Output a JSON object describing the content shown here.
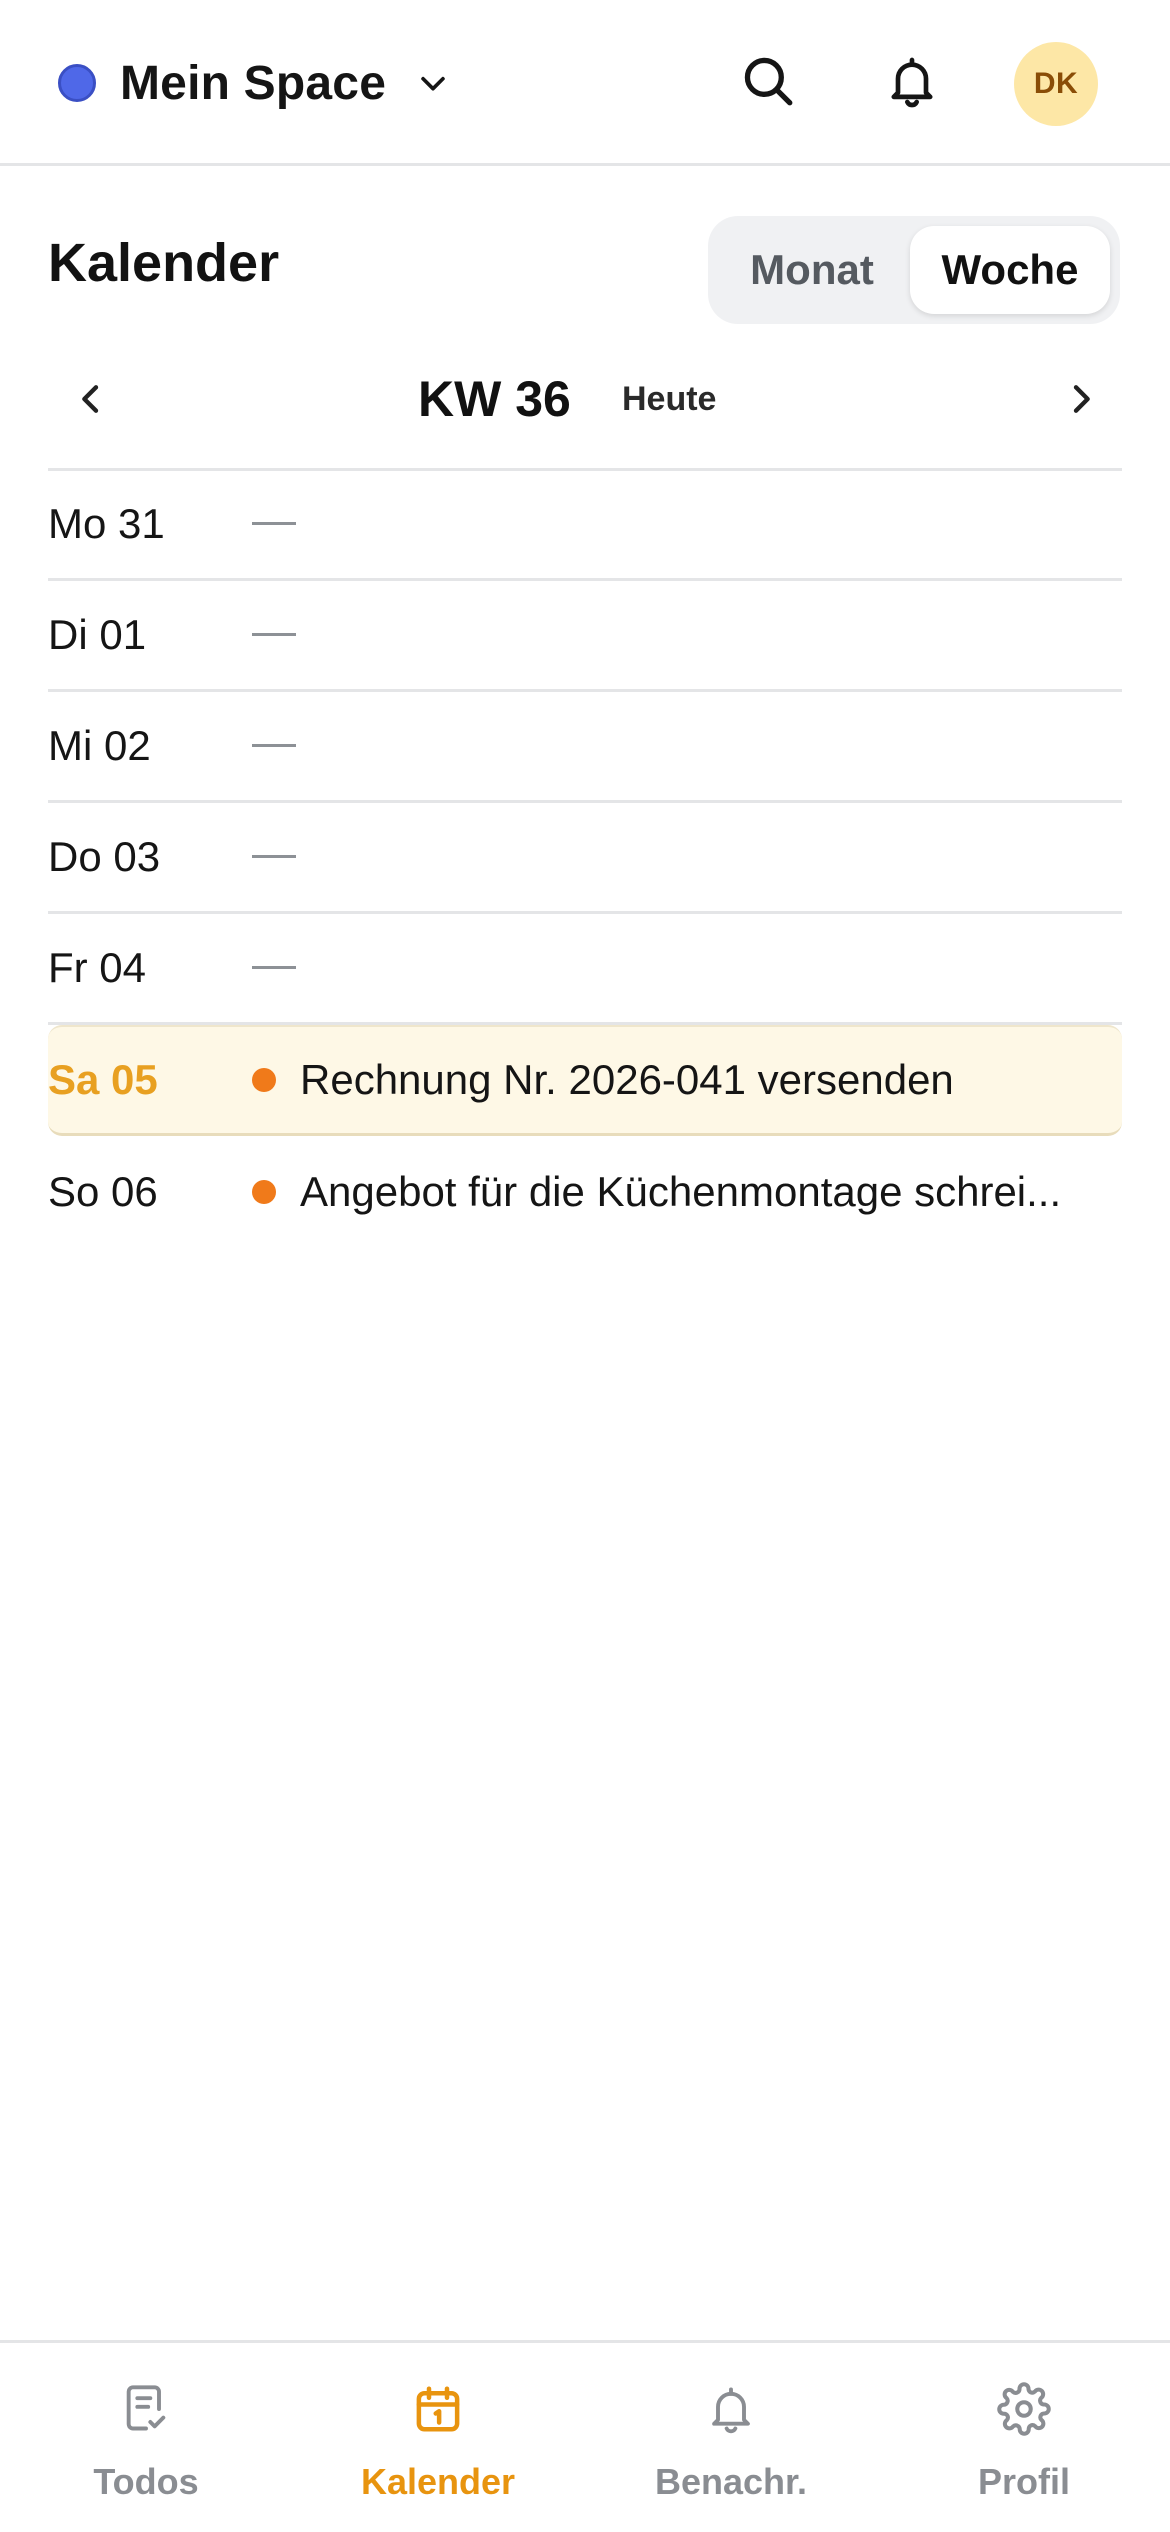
{
  "header": {
    "space_name": "Mein Space",
    "avatar_initials": "DK",
    "space_dot_color": "#4f68e8",
    "icons": [
      "chevron-down-icon",
      "search-icon",
      "bell-icon"
    ]
  },
  "page": {
    "title": "Kalender",
    "view_toggle": {
      "options": [
        "Monat",
        "Woche"
      ],
      "selected": "Woche"
    }
  },
  "week_nav": {
    "week_label": "KW 36",
    "today_label": "Heute",
    "icons": [
      "chevron-left-icon",
      "chevron-right-icon"
    ]
  },
  "days": [
    {
      "label": "Mo 31",
      "today": false,
      "event": null,
      "empty_marker": "—"
    },
    {
      "label": "Di 01",
      "today": false,
      "event": null,
      "empty_marker": "—"
    },
    {
      "label": "Mi 02",
      "today": false,
      "event": null,
      "empty_marker": "—"
    },
    {
      "label": "Do 03",
      "today": false,
      "event": null,
      "empty_marker": "—"
    },
    {
      "label": "Fr 04",
      "today": false,
      "event": null,
      "empty_marker": "—"
    },
    {
      "label": "Sa 05",
      "today": true,
      "event": "Rechnung Nr. 2026-041 versenden"
    },
    {
      "label": "So 06",
      "today": false,
      "event": "Angebot für die Küchenmontage schrei..."
    }
  ],
  "bottom_nav": {
    "items": [
      {
        "label": "Todos",
        "icon": "todo-list-icon",
        "active": false
      },
      {
        "label": "Kalender",
        "icon": "calendar-icon",
        "active": true
      },
      {
        "label": "Benachr.",
        "icon": "bell-icon",
        "active": false
      },
      {
        "label": "Profil",
        "icon": "gear-icon",
        "active": false
      }
    ]
  },
  "colors": {
    "accent": "#e8940f",
    "today_highlight": "#fef8e6",
    "event_dot": "#f07a1a",
    "avatar_bg": "#fde7a6"
  }
}
